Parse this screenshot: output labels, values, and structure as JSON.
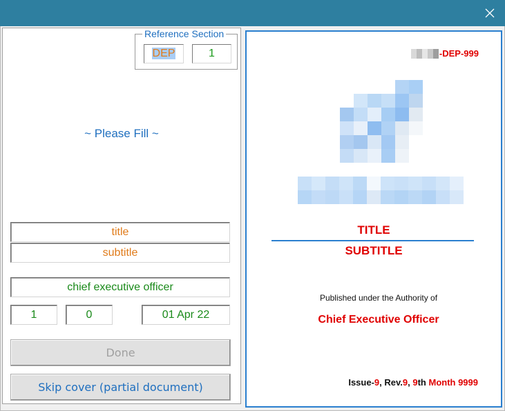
{
  "window": {
    "close_icon": "close-icon"
  },
  "reference_section": {
    "legend": "Reference Section",
    "prefix": "DEP",
    "number": "1"
  },
  "left": {
    "please_fill": "~ Please Fill ~",
    "title_field": "title",
    "subtitle_field": "subtitle",
    "authority_field": "chief executive officer",
    "issue_field": "1",
    "revision_field": "0",
    "date_field": "01 Apr 22",
    "done_button": "Done",
    "skip_button": "Skip cover (partial document)"
  },
  "cover": {
    "reference_suffix": "-DEP-999",
    "title": "TITLE",
    "subtitle": "SUBTITLE",
    "published_text": "Published under the Authority of",
    "authority": "Chief Executive Officer",
    "issue_label": "Issue-",
    "issue_value": "9",
    "sep1": ", ",
    "rev_label": "Rev.",
    "rev_value": "9",
    "sep2": ", ",
    "day_value": "9",
    "day_suffix": "th ",
    "month_text": "Month 9999"
  },
  "colors": {
    "titlebar": "#2e7fa0",
    "accent_blue": "#2a7fcf",
    "cover_red": "#e00000",
    "field_orange": "#e07b1a",
    "field_green": "#1a8a1a"
  }
}
